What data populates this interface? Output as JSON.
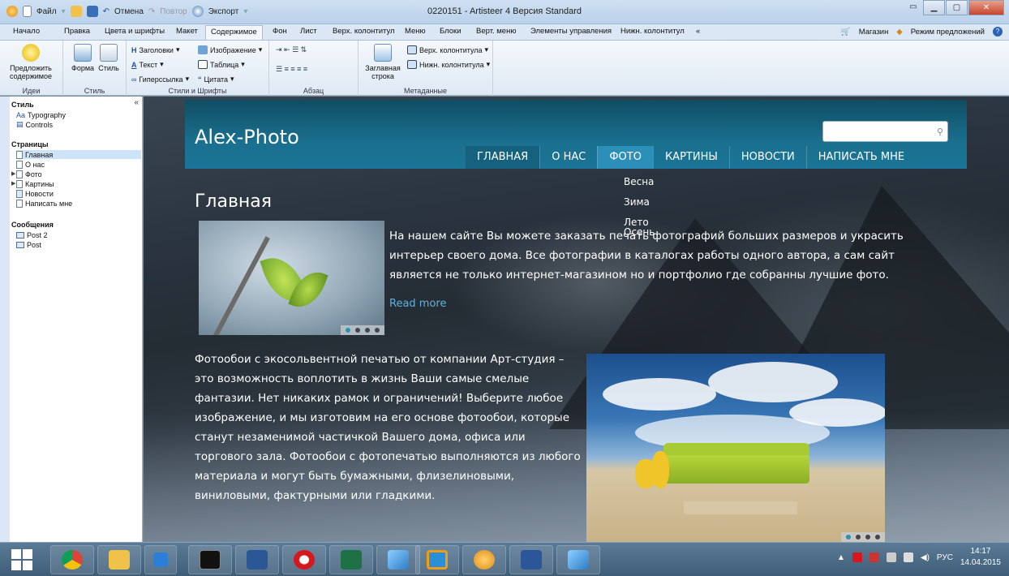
{
  "titlebar": {
    "title": "0220151 - Artisteer 4 Версия Standard",
    "file_menu": "Файл",
    "undo": "Отмена",
    "redo": "Повтор",
    "export": "Экспорт"
  },
  "menu_tabs": [
    "Начало",
    "Правка",
    "Цвета и шрифты",
    "Макет",
    "Содержимое",
    "Фон",
    "Лист",
    "Верх. колонтитул",
    "Меню",
    "Блоки",
    "Верт. меню",
    "Элементы управления",
    "Нижн. колонтитул",
    "«"
  ],
  "menu_right": {
    "shop": "Магазин",
    "suggest_mode": "Режим предложений"
  },
  "ribbon": {
    "ideas": {
      "label": "Идеи",
      "suggest": "Предложить содержимое"
    },
    "style": {
      "label": "Стиль",
      "form": "Форма",
      "style": "Стиль"
    },
    "styles_fonts": {
      "label": "Стили и Шрифты",
      "headings": "Заголовки",
      "text": "Текст",
      "hyperlink": "Гиперссылка",
      "image": "Изображение",
      "table": "Таблица",
      "quote": "Цитата"
    },
    "paragraph": {
      "label": "Абзац"
    },
    "metadata": {
      "label": "Метаданные",
      "title_line": "Заглавная строка",
      "header": "Верх. колонтитула",
      "footer": "Нижн. колонтитула"
    }
  },
  "left_panel": {
    "style_head": "Стиль",
    "style_items": [
      "Typography",
      "Controls"
    ],
    "pages_head": "Страницы",
    "pages": [
      "Главная",
      "О нас",
      "Фото",
      "Картины",
      "Новости",
      "Написать мне"
    ],
    "posts_head": "Сообщения",
    "posts": [
      "Post 2",
      "Post"
    ]
  },
  "site": {
    "logo": "Alex-Photo",
    "nav": [
      "ГЛАВНАЯ",
      "О НАС",
      "ФОТО",
      "КАРТИНЫ",
      "НОВОСТИ",
      "НАПИСАТЬ МНЕ"
    ],
    "dropdown": [
      "Весна",
      "Зима",
      "Лето",
      "Осень"
    ],
    "page_title": "Главная",
    "para1": "На нашем сайте Вы можете заказать печать фотографий больших размеров и украсить интерьер своего дома. Все фотографии в каталогах работы одного автора, а сам сайт является не только интернет-магазином но и портфолио где собранны лучшие фото.",
    "read_more": "Read more",
    "para2": "Фотообои с экосольвентной печатью от компании Арт-студия – это возможность воплотить в жизнь Ваши самые смелые фантазии. Нет никаких рамок и ограничений! Выберите любое изображение, и мы изготовим на его основе фотообои, которые станут незаменимой частичкой Вашего дома, офиса или торгового зала. Фотообои с фотопечатью выполняются из любого материала и могут быть бумажными, флизелиновыми, виниловыми, фактурными или гладкими."
  },
  "taskbar": {
    "lang": "РУС",
    "time": "14:17",
    "date": "14.04.2015"
  },
  "colors": {
    "accent": "#2b8fb8",
    "header": "#1a6f8e"
  }
}
